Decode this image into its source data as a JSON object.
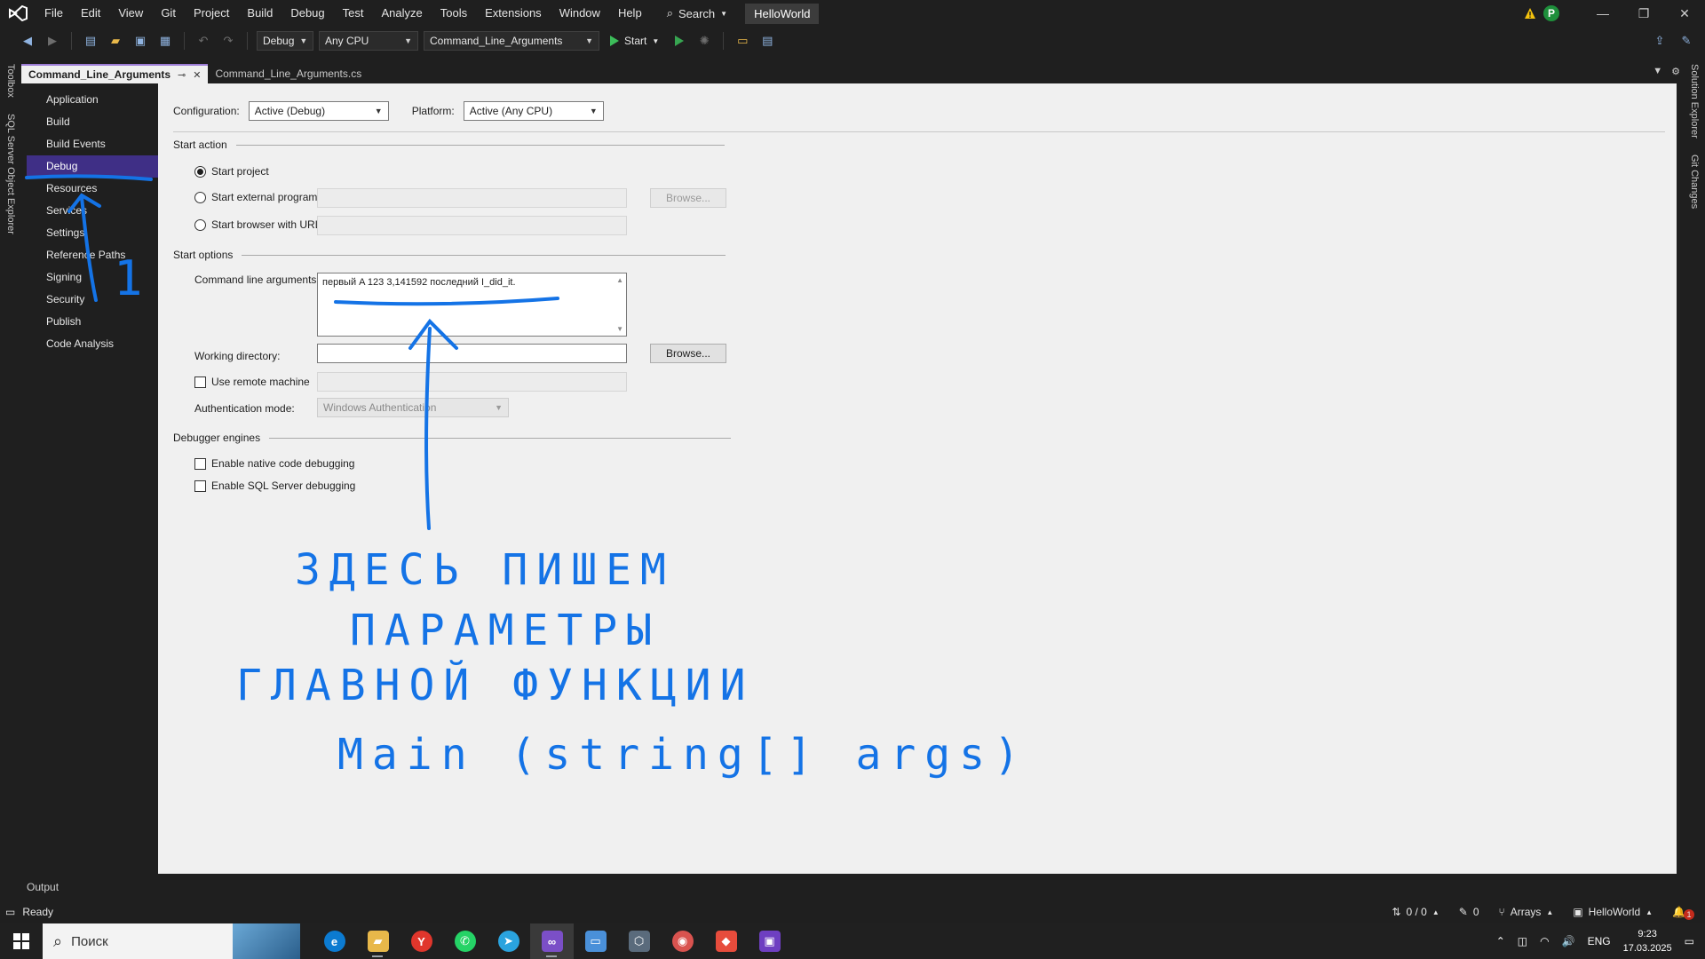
{
  "menu": [
    "File",
    "Edit",
    "View",
    "Git",
    "Project",
    "Build",
    "Debug",
    "Test",
    "Analyze",
    "Tools",
    "Extensions",
    "Window",
    "Help"
  ],
  "search_label": "Search",
  "solution_name": "HelloWorld",
  "account_initial": "P",
  "toolbar": {
    "config": "Debug",
    "platform": "Any CPU",
    "startup_project": "Command_Line_Arguments",
    "start_label": "Start"
  },
  "side_tools": {
    "toolbox": "Toolbox",
    "sql_explorer": "SQL Server Object Explorer",
    "solution_explorer": "Solution Explorer",
    "git_changes": "Git Changes"
  },
  "tabs": [
    {
      "label": "Command_Line_Arguments",
      "active": true
    },
    {
      "label": "Command_Line_Arguments.cs",
      "active": false
    }
  ],
  "nav": [
    "Application",
    "Build",
    "Build Events",
    "Debug",
    "Resources",
    "Services",
    "Settings",
    "Reference Paths",
    "Signing",
    "Security",
    "Publish",
    "Code Analysis"
  ],
  "nav_selected": "Debug",
  "debug_page": {
    "configuration_label": "Configuration:",
    "configuration_value": "Active (Debug)",
    "platform_label": "Platform:",
    "platform_value": "Active (Any CPU)",
    "start_action_header": "Start action",
    "start_project": "Start project",
    "start_external": "Start external program:",
    "start_browser": "Start browser with URL:",
    "browse": "Browse...",
    "start_options_header": "Start options",
    "cmd_args_label": "Command line arguments:",
    "cmd_args_value": "первый A 123 3,141592 последний I_did_it.",
    "working_dir_label": "Working directory:",
    "use_remote": "Use remote machine",
    "auth_mode_label": "Authentication mode:",
    "auth_mode_value": "Windows Authentication",
    "debugger_engines_header": "Debugger engines",
    "native_debugging": "Enable native code debugging",
    "sql_debugging": "Enable SQL Server debugging"
  },
  "annotation": {
    "lines": [
      "ЗДЕСЬ ПИШЕМ",
      "ПАРАМЕТРЫ",
      "ГЛАВНОЙ ФУНКЦИИ",
      "Main (string[] args)"
    ],
    "number": "1",
    "color": "#1473e6"
  },
  "output_tab": "Output",
  "status": {
    "ready": "Ready",
    "line_col": "0 / 0",
    "edits": "0",
    "branch": "Arrays",
    "repo": "HelloWorld",
    "notifications": "1"
  },
  "taskbar": {
    "search_placeholder": "Поиск",
    "language": "ENG",
    "time": "9:23",
    "date": "17.03.2025"
  }
}
